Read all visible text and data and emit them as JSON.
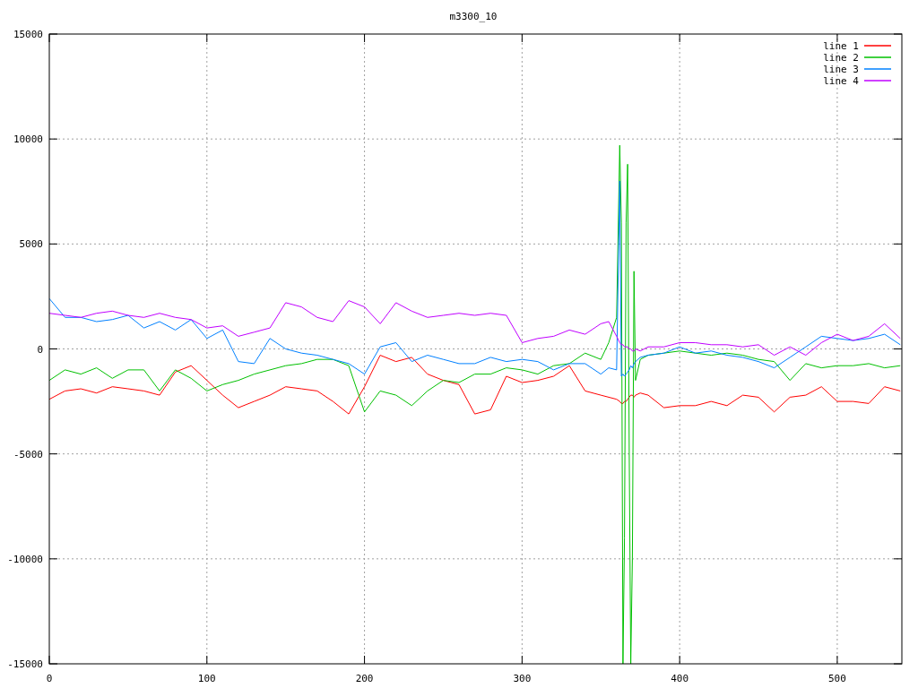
{
  "chart": {
    "chart_data": {
      "type": "line",
      "title": "m3300_10",
      "grid": true,
      "legend": true,
      "xlim": [
        0,
        541
      ],
      "ylim": [
        -15000,
        15000
      ],
      "xticks": [
        0,
        100,
        200,
        300,
        400,
        500
      ],
      "yticks": [
        -15000,
        -10000,
        -5000,
        0,
        5000,
        10000,
        15000
      ],
      "x": [
        0,
        10,
        20,
        30,
        40,
        50,
        60,
        70,
        80,
        90,
        100,
        110,
        120,
        130,
        140,
        150,
        160,
        170,
        180,
        190,
        200,
        210,
        220,
        230,
        240,
        250,
        260,
        270,
        280,
        290,
        300,
        310,
        320,
        330,
        340,
        350,
        355,
        360,
        362,
        363,
        364,
        365,
        366,
        367,
        368,
        369,
        370,
        371,
        372,
        375,
        380,
        390,
        400,
        410,
        420,
        430,
        440,
        450,
        460,
        470,
        480,
        490,
        500,
        510,
        520,
        530,
        540
      ],
      "series": [
        {
          "name": "line 1",
          "color": "#ff0000",
          "values": [
            -2400,
            -2000,
            -1900,
            -2100,
            -1800,
            -1900,
            -2000,
            -2200,
            -1100,
            -800,
            -1500,
            -2200,
            -2800,
            -2500,
            -2200,
            -1800,
            -1900,
            -2000,
            -2500,
            -3100,
            -1800,
            -300,
            -600,
            -400,
            -1200,
            -1500,
            -1700,
            -3100,
            -2900,
            -1300,
            -1600,
            -1500,
            -1300,
            -800,
            -2000,
            -2200,
            -2300,
            -2400,
            -2500,
            -2600,
            -2600,
            -2500,
            -2500,
            -2400,
            -2300,
            -2200,
            -2200,
            -2300,
            -2200,
            -2100,
            -2200,
            -2800,
            -2700,
            -2700,
            -2500,
            -2700,
            -2200,
            -2300,
            -3000,
            -2300,
            -2200,
            -1800,
            -2500,
            -2500,
            -2600,
            -1800,
            -2000
          ]
        },
        {
          "name": "line 2",
          "color": "#00c000",
          "values": [
            -1500,
            -1000,
            -1200,
            -900,
            -1400,
            -1000,
            -1000,
            -2000,
            -1000,
            -1400,
            -2000,
            -1700,
            -1500,
            -1200,
            -1000,
            -800,
            -700,
            -500,
            -500,
            -800,
            -3000,
            -2000,
            -2200,
            -2700,
            -2000,
            -1500,
            -1600,
            -1200,
            -1200,
            -900,
            -1000,
            -1200,
            -800,
            -700,
            -200,
            -500,
            300,
            1500,
            9700,
            6000,
            -15000,
            -9000,
            6000,
            8800,
            -5000,
            -15000,
            -10000,
            3700,
            -1500,
            -500,
            -300,
            -200,
            -100,
            -200,
            -300,
            -200,
            -300,
            -500,
            -600,
            -1500,
            -700,
            -900,
            -800,
            -800,
            -700,
            -900,
            -800
          ]
        },
        {
          "name": "line 3",
          "color": "#0080ff",
          "values": [
            2400,
            1500,
            1500,
            1300,
            1400,
            1600,
            1000,
            1300,
            900,
            1400,
            500,
            900,
            -600,
            -700,
            500,
            0,
            -200,
            -300,
            -500,
            -700,
            -1200,
            100,
            300,
            -600,
            -300,
            -500,
            -700,
            -700,
            -400,
            -600,
            -500,
            -600,
            -1000,
            -700,
            -700,
            -1200,
            -900,
            -1000,
            8000,
            -1300,
            -1200,
            -1300,
            -1200,
            -1100,
            -1000,
            -800,
            -900,
            -700,
            -600,
            -400,
            -300,
            -200,
            100,
            -200,
            -100,
            -300,
            -400,
            -600,
            -900,
            -400,
            100,
            600,
            500,
            400,
            500,
            700,
            200
          ]
        },
        {
          "name": "line 4",
          "color": "#c000ff",
          "values": [
            1700,
            1600,
            1500,
            1700,
            1800,
            1600,
            1500,
            1700,
            1500,
            1400,
            1000,
            1100,
            600,
            800,
            1000,
            2200,
            2000,
            1500,
            1300,
            2300,
            2000,
            1200,
            2200,
            1800,
            1500,
            1600,
            1700,
            1600,
            1700,
            1600,
            300,
            500,
            600,
            900,
            700,
            1200,
            1300,
            600,
            300,
            200,
            200,
            100,
            100,
            100,
            0,
            0,
            -100,
            -100,
            0,
            -100,
            100,
            100,
            300,
            300,
            200,
            200,
            100,
            200,
            -300,
            100,
            -300,
            300,
            700,
            400,
            600,
            1200,
            500
          ]
        }
      ]
    }
  }
}
